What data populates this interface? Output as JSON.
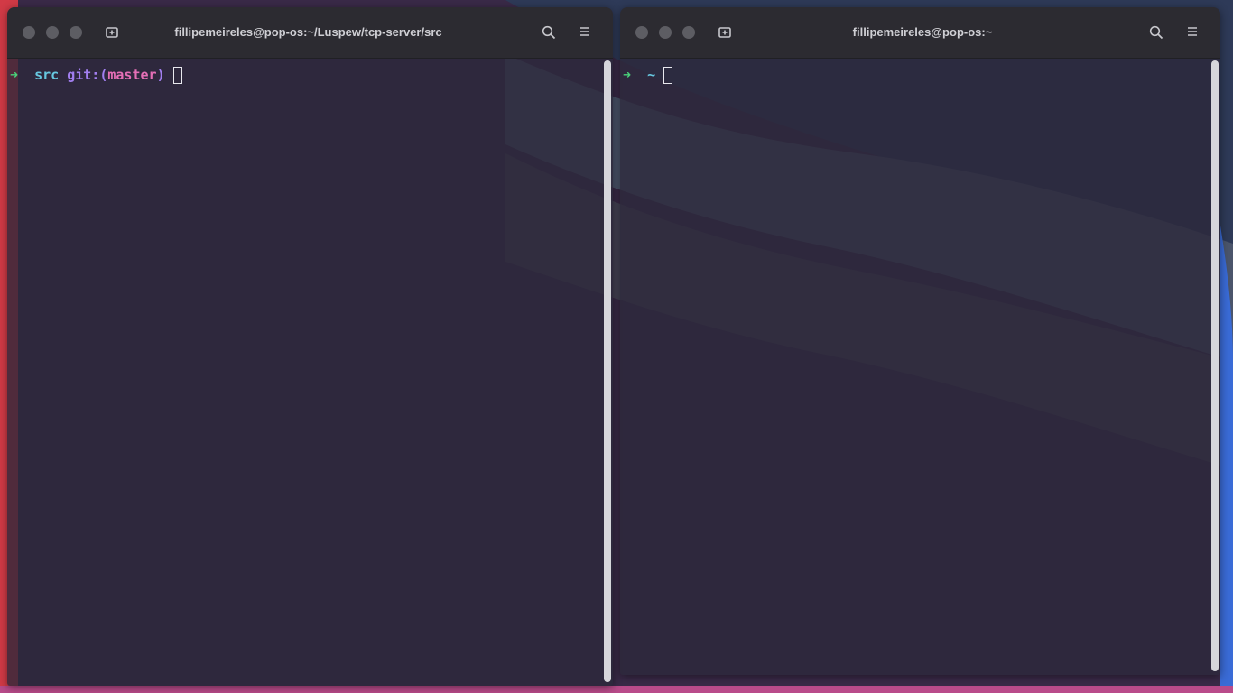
{
  "desktop": {
    "colors": {
      "sky": "#2f3a55",
      "band_light": "#4b556b",
      "band_mid": "#454053",
      "dune": "#3e3148",
      "edge_red": "#e0373b",
      "edge_blue": "#3a6bd6"
    }
  },
  "left_window": {
    "title": "fillipemeireles@pop-os:~/Luspew/tcp-server/src",
    "new_tab_icon": "new-tab-icon",
    "search_icon": "search-icon",
    "menu_icon": "hamburger-menu-icon",
    "prompt": {
      "arrow": "➜",
      "directory": "src",
      "git_label": "git:(",
      "branch": "master",
      "git_close": ")"
    }
  },
  "right_window": {
    "title": "fillipemeireles@pop-os:~",
    "new_tab_icon": "new-tab-icon",
    "search_icon": "search-icon",
    "menu_icon": "hamburger-menu-icon",
    "prompt": {
      "arrow": "➜",
      "directory": "~"
    }
  }
}
